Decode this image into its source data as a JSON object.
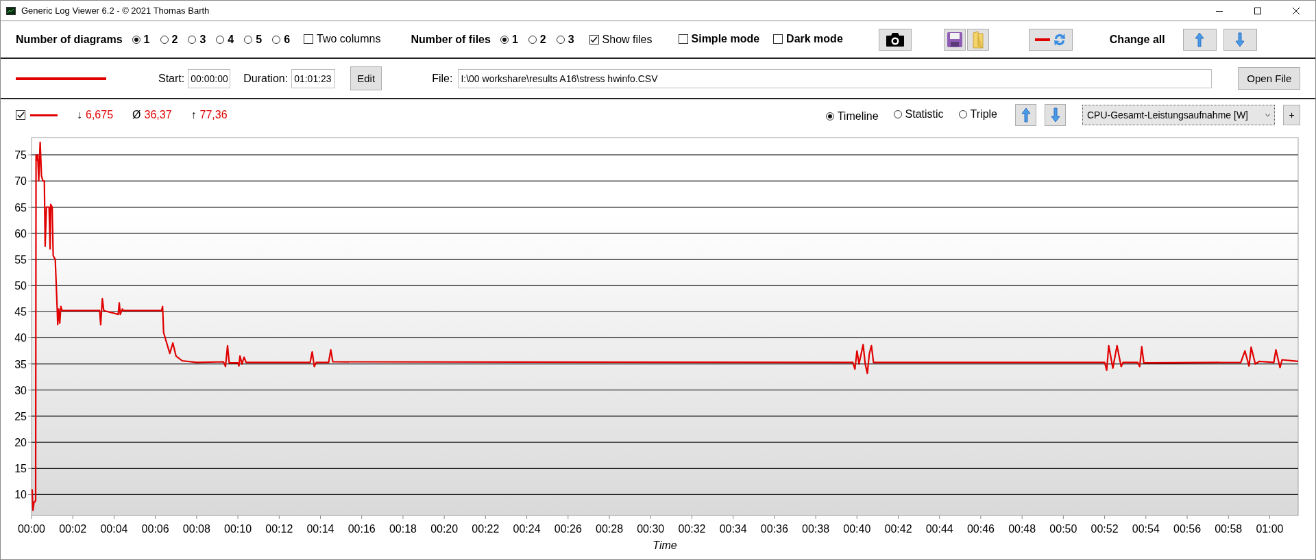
{
  "window": {
    "title": "Generic Log Viewer 6.2 - © 2021 Thomas Barth"
  },
  "toolbar": {
    "diagrams_label": "Number of diagrams",
    "diagram_options": [
      {
        "label": "1",
        "selected": true
      },
      {
        "label": "2",
        "selected": false
      },
      {
        "label": "3",
        "selected": false
      },
      {
        "label": "4",
        "selected": false
      },
      {
        "label": "5",
        "selected": false
      },
      {
        "label": "6",
        "selected": false
      }
    ],
    "two_columns": {
      "label": "Two columns",
      "checked": false
    },
    "files_label": "Number of files",
    "file_options": [
      {
        "label": "1",
        "selected": true
      },
      {
        "label": "2",
        "selected": false
      },
      {
        "label": "3",
        "selected": false
      }
    ],
    "show_files": {
      "label": "Show files",
      "checked": true
    },
    "simple_mode": {
      "label": "Simple mode",
      "checked": false
    },
    "dark_mode": {
      "label": "Dark mode",
      "checked": false
    },
    "change_all_label": "Change all"
  },
  "file_row": {
    "start_label": "Start:",
    "start": "00:00:00",
    "duration_label": "Duration:",
    "duration": "01:01:23",
    "edit_button": "Edit",
    "file_label": "File:",
    "file_path": "I:\\00 workshare\\results A16\\stress hwinfo.CSV",
    "open_button": "Open File"
  },
  "diagram": {
    "series_visible": true,
    "stats": [
      {
        "symbol": "↓",
        "value": "6,675"
      },
      {
        "symbol": "Ø",
        "value": "36,37"
      },
      {
        "symbol": "↑",
        "value": "77,36"
      }
    ],
    "views": [
      {
        "label": "Timeline",
        "selected": true
      },
      {
        "label": "Statistic",
        "selected": false
      },
      {
        "label": "Triple",
        "selected": false
      }
    ],
    "channel": "CPU-Gesamt-Leistungsaufnahme [W]",
    "add_button": "+",
    "chart_data": {
      "type": "line",
      "grid": true,
      "xlabel": "Time",
      "xlim": [
        0,
        61.38
      ],
      "ylim": [
        6,
        78.3
      ],
      "xticks": [
        {
          "value": 0,
          "label": "00:00"
        },
        {
          "value": 2,
          "label": "00:02"
        },
        {
          "value": 4,
          "label": "00:04"
        },
        {
          "value": 6,
          "label": "00:06"
        },
        {
          "value": 8,
          "label": "00:08"
        },
        {
          "value": 10,
          "label": "00:10"
        },
        {
          "value": 12,
          "label": "00:12"
        },
        {
          "value": 14,
          "label": "00:14"
        },
        {
          "value": 16,
          "label": "00:16"
        },
        {
          "value": 18,
          "label": "00:18"
        },
        {
          "value": 20,
          "label": "00:20"
        },
        {
          "value": 22,
          "label": "00:22"
        },
        {
          "value": 24,
          "label": "00:24"
        },
        {
          "value": 26,
          "label": "00:26"
        },
        {
          "value": 28,
          "label": "00:28"
        },
        {
          "value": 30,
          "label": "00:30"
        },
        {
          "value": 32,
          "label": "00:32"
        },
        {
          "value": 34,
          "label": "00:34"
        },
        {
          "value": 36,
          "label": "00:36"
        },
        {
          "value": 38,
          "label": "00:38"
        },
        {
          "value": 40,
          "label": "00:40"
        },
        {
          "value": 42,
          "label": "00:42"
        },
        {
          "value": 44,
          "label": "00:44"
        },
        {
          "value": 46,
          "label": "00:46"
        },
        {
          "value": 48,
          "label": "00:48"
        },
        {
          "value": 50,
          "label": "00:50"
        },
        {
          "value": 52,
          "label": "00:52"
        },
        {
          "value": 54,
          "label": "00:54"
        },
        {
          "value": 56,
          "label": "00:56"
        },
        {
          "value": 58,
          "label": "00:58"
        },
        {
          "value": 60,
          "label": "01:00"
        }
      ],
      "yticks": [
        10,
        15,
        20,
        25,
        30,
        35,
        40,
        45,
        50,
        55,
        60,
        65,
        70,
        75
      ],
      "x": [
        0.03,
        0.07,
        0.12,
        0.2,
        0.22,
        0.28,
        0.3,
        0.35,
        0.42,
        0.48,
        0.55,
        0.62,
        0.66,
        0.72,
        0.85,
        0.9,
        0.93,
        1.0,
        1.05,
        1.15,
        1.25,
        1.27,
        1.32,
        1.37,
        1.42,
        1.48,
        3.3,
        3.35,
        3.43,
        3.5,
        4.2,
        4.25,
        4.3,
        4.4,
        4.45,
        6.3,
        6.35,
        6.4,
        6.55,
        6.7,
        6.85,
        7.0,
        7.3,
        8.0,
        9.3,
        9.4,
        9.5,
        9.58,
        10.0,
        10.05,
        10.1,
        10.2,
        10.3,
        10.4,
        13.5,
        13.6,
        13.7,
        13.8,
        14.4,
        14.5,
        14.6,
        39.8,
        39.9,
        40.0,
        40.1,
        40.3,
        40.4,
        40.5,
        40.6,
        40.7,
        40.8,
        52.0,
        52.1,
        52.2,
        52.4,
        52.6,
        52.8,
        52.9,
        53.6,
        53.7,
        53.8,
        53.9,
        58.6,
        58.8,
        59.0,
        59.1,
        59.3,
        59.5,
        60.2,
        60.3,
        60.5,
        60.6,
        61.38
      ],
      "series": [
        {
          "color": "#e00000",
          "values": [
            11,
            7,
            8.5,
            8.8,
            75,
            74,
            75,
            70,
            77.4,
            71,
            70,
            70,
            57.5,
            65,
            65,
            57,
            65.5,
            65,
            55.7,
            55,
            45,
            42.5,
            45.5,
            42.8,
            46,
            45.2,
            45.2,
            42.5,
            47.5,
            45.2,
            44.5,
            46.7,
            44.5,
            45.5,
            45.2,
            45.2,
            46,
            41,
            39,
            37,
            39,
            36.5,
            35.6,
            35.3,
            35.4,
            34.5,
            38.5,
            35.2,
            35.2,
            34.6,
            36.5,
            35,
            36.3,
            35.3,
            35.3,
            37.3,
            34.5,
            35.3,
            35.3,
            37.7,
            35.4,
            35.3,
            34,
            37.5,
            35,
            38.7,
            35,
            33.2,
            37,
            38.5,
            35.3,
            35.3,
            33.8,
            38.5,
            34.2,
            38.5,
            34.5,
            35.3,
            35.3,
            34.5,
            38.3,
            35.2,
            35.3,
            37.5,
            34.6,
            38.2,
            35,
            35.5,
            35.3,
            37.7,
            34.3,
            35.8,
            35.5
          ]
        }
      ]
    }
  }
}
